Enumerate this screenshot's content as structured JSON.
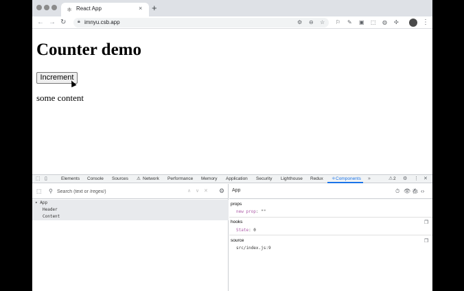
{
  "browser": {
    "tab_title": "React App",
    "tab_favicon": "⚛",
    "tab_close": "×",
    "new_tab": "+",
    "url": "imnyu.csb.app",
    "nav": {
      "back": "←",
      "forward": "→",
      "reload": "↻"
    }
  },
  "page": {
    "heading": "Counter demo",
    "button_label": "Increment",
    "content_text": "some content"
  },
  "devtools": {
    "tabs": [
      "Elements",
      "Console",
      "Sources",
      "Network",
      "Performance",
      "Memory",
      "Application",
      "Security",
      "Lighthouse",
      "Redux",
      "Components"
    ],
    "network_warning": "⚠",
    "active_tab": "Components",
    "active_tab_prefix": "⚛",
    "more_tabs": "»",
    "warning_count": "2",
    "search_placeholder": "Search (text or /regex/)",
    "tree": {
      "app": "▾ App",
      "header": "Header",
      "content": "Content"
    },
    "selected_component": "App",
    "props": {
      "title": "props",
      "key": "new prop",
      "value": "\"\""
    },
    "hooks": {
      "title": "hooks",
      "key": "State",
      "value": "0"
    },
    "source": {
      "title": "source",
      "value": "src/index.js:9"
    }
  },
  "colors": {
    "accent": "#1a73e8",
    "selected_row": "#e8eaed"
  }
}
